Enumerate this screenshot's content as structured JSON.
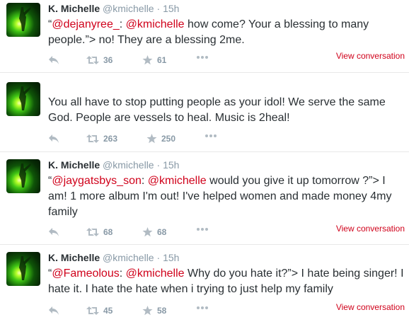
{
  "tweets": [
    {
      "name": "K. Michelle",
      "handle": "@kmichelle",
      "separator": "·",
      "time": "15h",
      "body": [
        {
          "t": "“",
          "m": false
        },
        {
          "t": "@dejanyree_",
          "m": true
        },
        {
          "t": ": ",
          "m": false
        },
        {
          "t": "@kmichelle",
          "m": true
        },
        {
          "t": " how come? Your a blessing to many people.”> no! They are a blessing 2me.",
          "m": false
        }
      ],
      "retweets": "36",
      "favorites": "61",
      "view_conversation": "View conversation"
    },
    {
      "body": [
        {
          "t": "You all have to stop putting people as your idol! We serve the same God. People are vessels to heal. Music is 2heal!",
          "m": false
        }
      ],
      "retweets": "263",
      "favorites": "250"
    },
    {
      "name": "K. Michelle",
      "handle": "@kmichelle",
      "separator": "·",
      "time": "15h",
      "body": [
        {
          "t": "“",
          "m": false
        },
        {
          "t": "@jaygatsbys_son",
          "m": true
        },
        {
          "t": ": ",
          "m": false
        },
        {
          "t": "@kmichelle",
          "m": true
        },
        {
          "t": " would you give it up tomorrow ?”> I am! 1 more album I'm out! I've helped women and made money 4my family",
          "m": false
        }
      ],
      "retweets": "68",
      "favorites": "68",
      "view_conversation": "View conversation"
    },
    {
      "name": "K. Michelle",
      "handle": "@kmichelle",
      "separator": "·",
      "time": "15h",
      "body": [
        {
          "t": "“",
          "m": false
        },
        {
          "t": "@Fameolous",
          "m": true
        },
        {
          "t": ": ",
          "m": false
        },
        {
          "t": "@kmichelle",
          "m": true
        },
        {
          "t": " Why do you hate it?”> I hate being singer! I hate it. I hate the hate when i trying to just help my family",
          "m": false
        }
      ],
      "retweets": "45",
      "favorites": "58",
      "view_conversation": "View conversation"
    }
  ],
  "colors": {
    "mention": "#d0021b",
    "meta": "#8899a6",
    "text": "#292f33",
    "divider": "#e8e8e8"
  },
  "icons": {
    "reply": "reply-icon",
    "retweet": "retweet-icon",
    "favorite": "star-icon",
    "more": "more-icon"
  }
}
